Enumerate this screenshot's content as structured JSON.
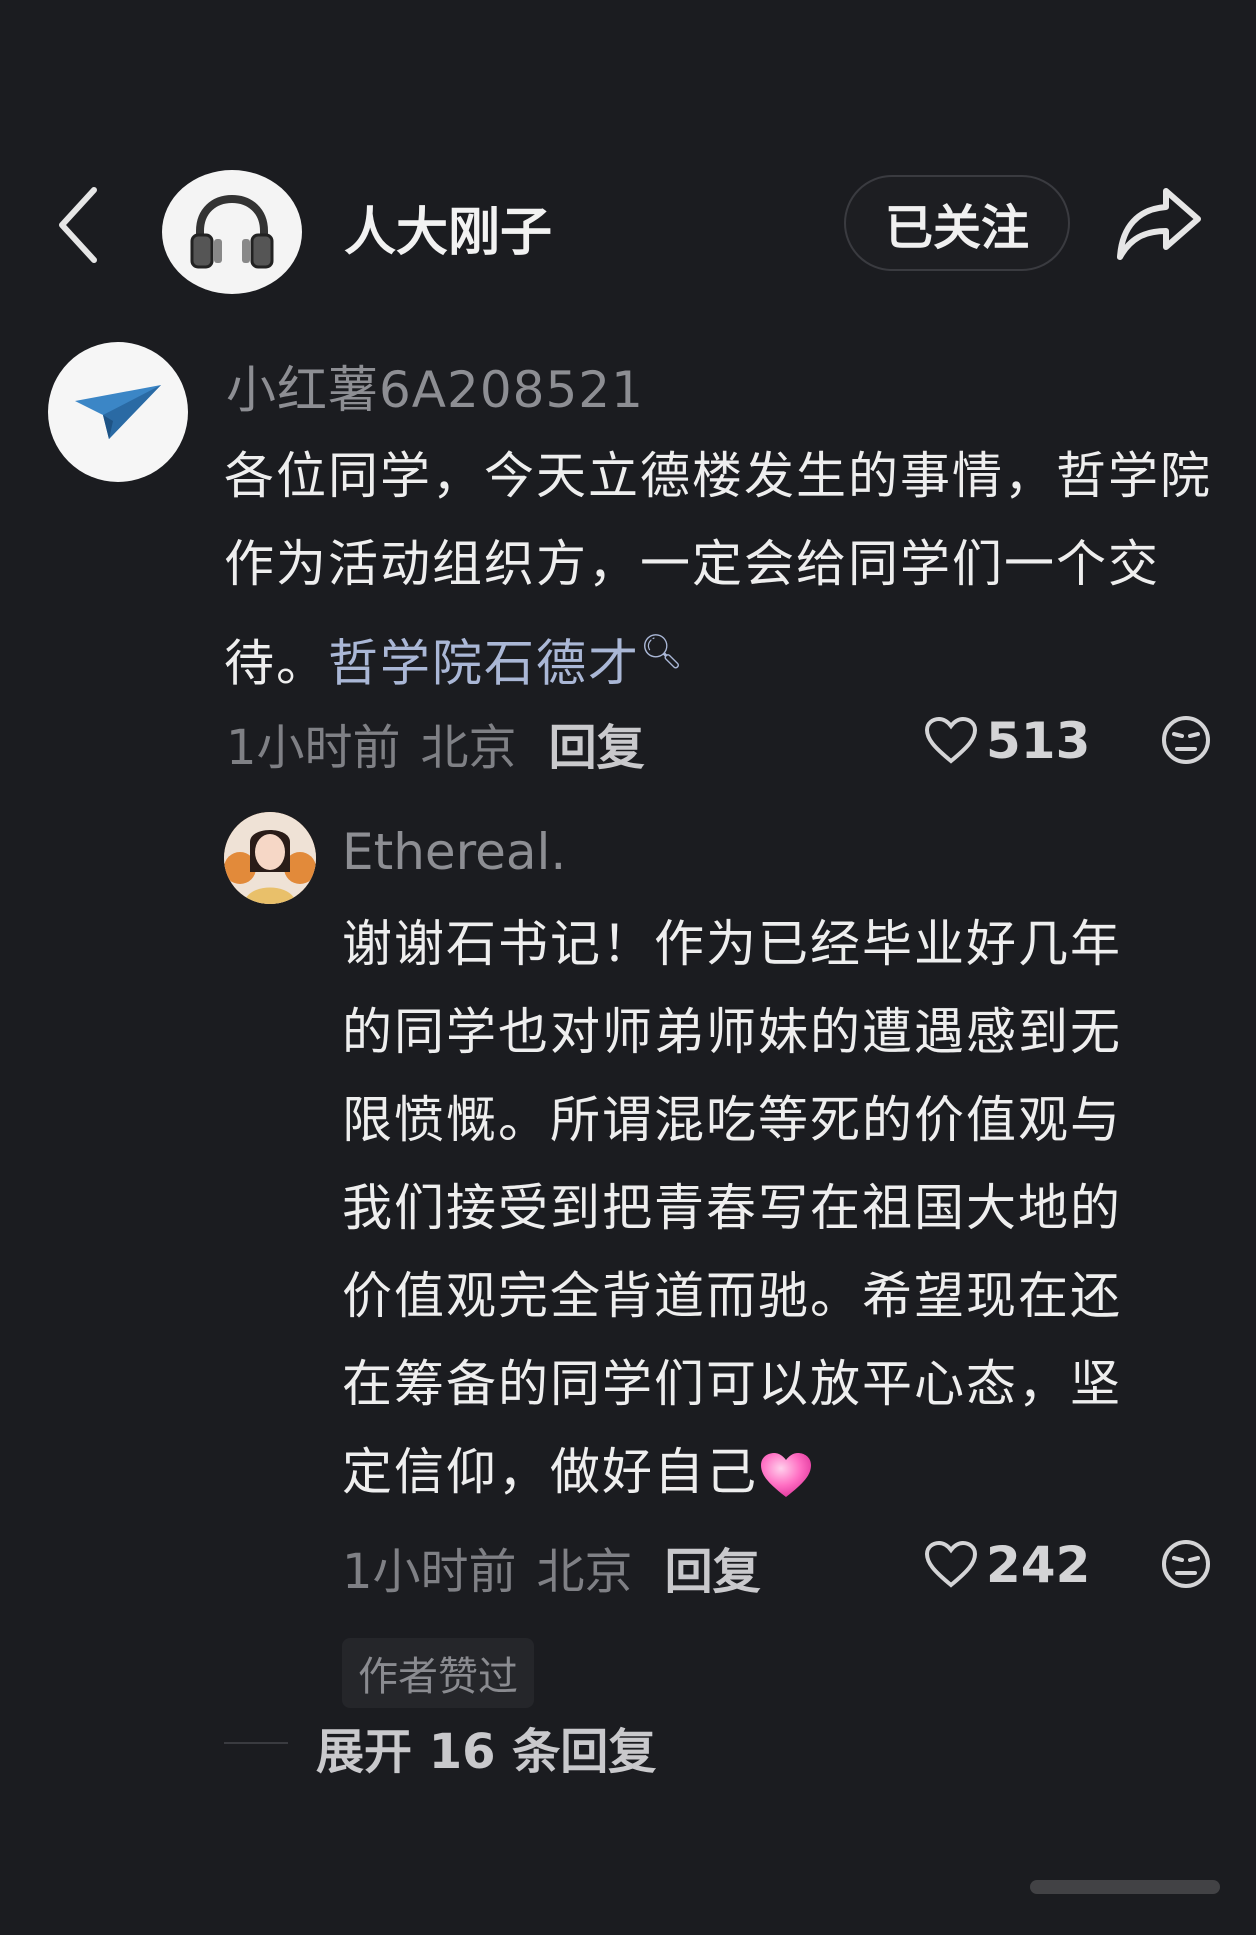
{
  "header": {
    "author_name": "人大刚子",
    "follow_label": "已关注",
    "back_icon": "chevron-left-icon",
    "share_icon": "share-arrow-icon",
    "avatar_icon": "headphones-icon"
  },
  "comment": {
    "username": "小红薯6A208521",
    "avatar_icon": "paper-plane-icon",
    "text_before": "各位同学，今天立德楼发生的事情，哲学院作为活动组织方，一定会给同学们一个交待。",
    "mention": "哲学院石德才",
    "time": "1小时前",
    "location": "北京",
    "reply_label": "回复",
    "likes": "513"
  },
  "reply": {
    "username": "Ethereal.",
    "text": "谢谢石书记！作为已经毕业好几年的同学也对师弟师妹的遭遇感到无限愤慨。所谓混吃等死的价值观与我们接受到把青春写在祖国大地的价值观完全背道而驰。希望现在还在筹备的同学们可以放平心态，坚定信仰，做好自己",
    "time": "1小时前",
    "location": "北京",
    "reply_label": "回复",
    "likes": "242",
    "author_liked": "作者赞过"
  },
  "expand_label": "展开 16 条回复",
  "colors": {
    "background": "#1b1c20",
    "mention": "#aab7d6",
    "plane": "#3b86c6"
  }
}
